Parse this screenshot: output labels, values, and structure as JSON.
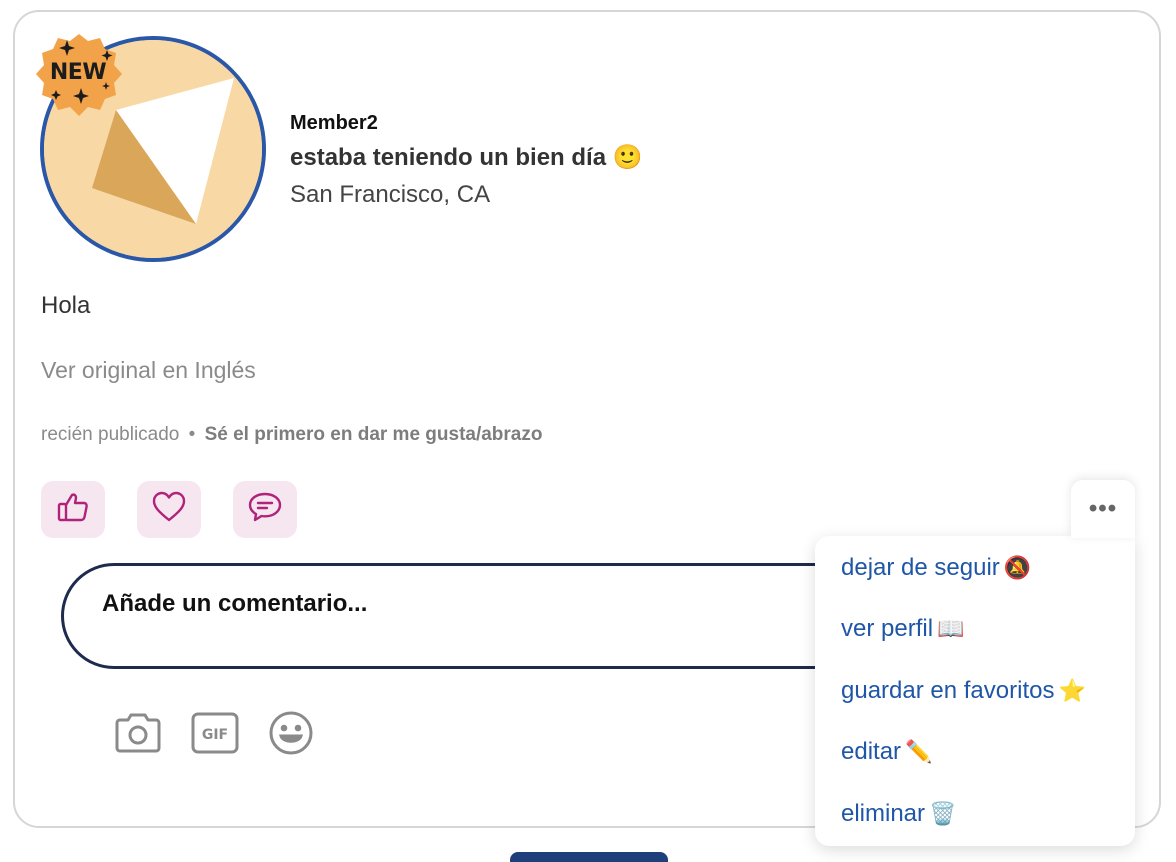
{
  "post": {
    "badge": "NEW",
    "member_name": "Member2",
    "status": "estaba teniendo un bien día 🙂",
    "location": "San Francisco, CA",
    "body": "Hola",
    "view_original": "Ver original en Inglés",
    "meta_time": "recién publicado",
    "meta_separator": "•",
    "meta_cta": "Sé el primero en dar me gusta/abrazo"
  },
  "reactions": [
    {
      "name": "like",
      "icon": "thumbs-up-icon"
    },
    {
      "name": "love",
      "icon": "heart-icon"
    },
    {
      "name": "comment",
      "icon": "speech-bubble-icon"
    }
  ],
  "comment": {
    "placeholder": "Añade un comentario..."
  },
  "tools": [
    {
      "icon": "camera-icon"
    },
    {
      "icon": "gif-icon",
      "label": "GIF"
    },
    {
      "icon": "smiley-icon"
    }
  ],
  "menu": {
    "more_label": "•••",
    "items": [
      {
        "label": "dejar de seguir",
        "emoji": "🔕"
      },
      {
        "label": "ver perfil",
        "emoji": "📖"
      },
      {
        "label": "guardar en favoritos",
        "emoji": "⭐"
      },
      {
        "label": "editar",
        "emoji": "✏️"
      },
      {
        "label": "eliminar",
        "emoji": "🗑️"
      }
    ]
  },
  "colors": {
    "accent_blue": "#1f56a8",
    "reaction_bg": "#f6e6ef",
    "reaction_icon": "#b0237a",
    "avatar_ring": "#2a57a8",
    "badge_orange": "#f2a34a"
  }
}
